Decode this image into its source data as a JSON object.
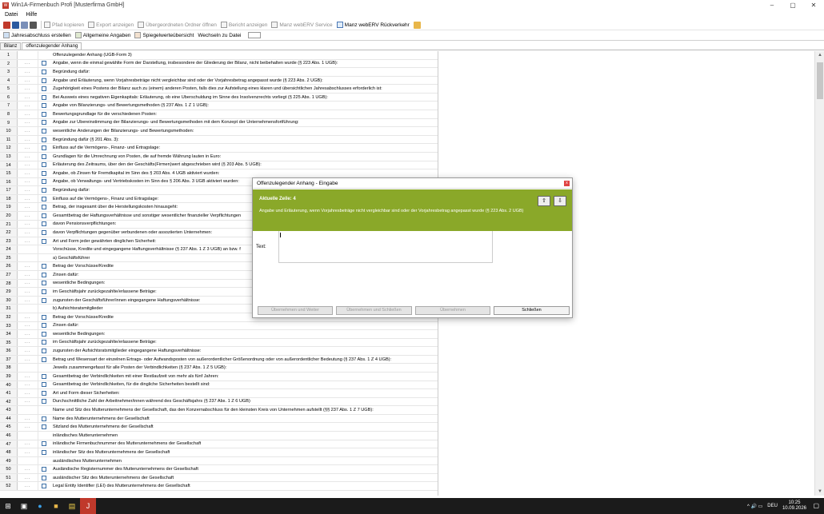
{
  "app": {
    "title": "Win1A-Firmenbuch Profi [Musterfirma GmbH]",
    "icon_label": "W",
    "minimize": "–",
    "maximize": "▢",
    "close": "✕"
  },
  "menu": [
    "Datei",
    "Hilfe"
  ],
  "toolbar1": {
    "buttons": [
      {
        "label": "Pfad kopieren",
        "enabled": false
      },
      {
        "label": "Export anzeigen",
        "enabled": false
      },
      {
        "label": "Übergeordneten Ordner öffnen",
        "enabled": false
      },
      {
        "label": "Bericht anzeigen",
        "enabled": false
      },
      {
        "label": "Manz webERV Service",
        "enabled": false
      },
      {
        "label": "Manz webERV Rückverkehr",
        "enabled": true
      }
    ]
  },
  "toolbar2": {
    "buttons": [
      {
        "label": "Jahresabschluss erstellen"
      },
      {
        "label": "Allgemeine Angaben"
      },
      {
        "label": "Spiegelwerteübersicht"
      },
      {
        "label": "Wechseln zu Datei"
      }
    ]
  },
  "tabs": [
    {
      "label": "Bilanz",
      "active": false
    },
    {
      "label": "offenzulegender Anhang",
      "active": true
    }
  ],
  "rows": [
    {
      "n": "1",
      "btn": false,
      "chk": false,
      "text": "Offenzulegender Anhang  (UGB-Form 3)"
    },
    {
      "n": "2",
      "btn": true,
      "chk": true,
      "text": "Angabe, wenn die einmal gewählte Form der Darstellung, insbesondere der Gliederung der Bilanz, nicht beibehalten wurde (§ 223 Abs. 1 UGB):"
    },
    {
      "n": "3",
      "btn": true,
      "chk": true,
      "text": "Begründung dafür:"
    },
    {
      "n": "4",
      "btn": true,
      "chk": true,
      "text": "Angabe und Erläuterung, wenn Vorjahresbeträge nicht vergleichbar sind oder der Vorjahresbetrag angepasst wurde (§ 223 Abs. 2 UGB):"
    },
    {
      "n": "5",
      "btn": true,
      "chk": true,
      "text": "Zugehörigkeit eines Postens der Bilanz auch zu (einem) anderen Posten, falls dies zur Aufstellung eines klaren und übersichtlichen Jahresabschlusses erforderlich ist:"
    },
    {
      "n": "6",
      "btn": true,
      "chk": true,
      "text": "Bei Ausweis eines negativen Eigenkapitals: Erläuterung, ob eine Überschuldung im Sinne des Insolvenzrechts vorliegt (§ 225 Abs. 1 UGB):"
    },
    {
      "n": "7",
      "btn": true,
      "chk": true,
      "text": "Angabe von Bilanzierungs- und Bewertungsmethoden (§ 237 Abs. 1 Z 1 UGB):"
    },
    {
      "n": "8",
      "btn": true,
      "chk": true,
      "text": "Bewertungsgrundlage für die verschiedenen Posten:"
    },
    {
      "n": "9",
      "btn": true,
      "chk": true,
      "text": "Angabe zur Übereinstimmung der Bilanzierungs- und Bewertungsmethoden mit dem Konzept der Unternehmensfortführung:"
    },
    {
      "n": "10",
      "btn": true,
      "chk": true,
      "text": "wesentliche Änderungen der Bilanzierungs- und Bewertungsmethoden:"
    },
    {
      "n": "11",
      "btn": true,
      "chk": true,
      "text": "Begründung dafür (§ 201 Abs. 3):"
    },
    {
      "n": "12",
      "btn": true,
      "chk": true,
      "text": "Einfluss auf die Vermögens-, Finanz- und Ertragslage:"
    },
    {
      "n": "13",
      "btn": true,
      "chk": true,
      "text": "Grundlagen für die Umrechnung von Posten, die auf fremde Währung lauten in Euro:"
    },
    {
      "n": "14",
      "btn": true,
      "chk": true,
      "text": "Erläuterung des Zeitraums, über den der Geschäfts(Firmen)wert abgeschrieben wird (§ 203 Abs. 5 UGB):"
    },
    {
      "n": "15",
      "btn": true,
      "chk": true,
      "text": "Angabe, ob Zinsen für Fremdkapital im Sinn des § 203 Abs. 4 UGB aktiviert wurden:"
    },
    {
      "n": "16",
      "btn": true,
      "chk": true,
      "text": "Angabe, ob Verwaltungs- und Vertriebskosten im Sinn des § 206 Abs. 3 UGB aktiviert wurden:"
    },
    {
      "n": "17",
      "btn": true,
      "chk": true,
      "text": "Begründung dafür:"
    },
    {
      "n": "18",
      "btn": true,
      "chk": true,
      "text": "Einfluss auf die Vermögens-, Finanz und Ertragslage:"
    },
    {
      "n": "19",
      "btn": true,
      "chk": true,
      "text": "Betrag, der insgesamt über die Herstellungskosten hinausgeht:"
    },
    {
      "n": "20",
      "btn": true,
      "chk": true,
      "text": "Gesamtbetrag der Haftungsverhältnisse und sonstiger wesentlicher finanzieller Verpflichtungen"
    },
    {
      "n": "21",
      "btn": true,
      "chk": true,
      "text": "davon Pensionsverpflichtungen:"
    },
    {
      "n": "22",
      "btn": true,
      "chk": true,
      "text": "davon Verpflichtungen gegenüber verbundenen oder assoziierten Unternehmen:"
    },
    {
      "n": "23",
      "btn": true,
      "chk": true,
      "text": "Art und Form jeder gewährten dinglichen Sicherheit:"
    },
    {
      "n": "24",
      "btn": false,
      "chk": false,
      "text": "Vorschüsse, Kredite und eingegangene Haftungsverhältnisse (§ 237 Abs. 1 Z 3 UGB) an bzw. f"
    },
    {
      "n": "25",
      "btn": false,
      "chk": false,
      "text": "a) Geschäftsführer"
    },
    {
      "n": "26",
      "btn": true,
      "chk": true,
      "text": "Betrag der Vorschüsse/Kredite"
    },
    {
      "n": "27",
      "btn": true,
      "chk": true,
      "text": "Zinsen dafür:"
    },
    {
      "n": "28",
      "btn": true,
      "chk": true,
      "text": "wesentliche Bedingungen:"
    },
    {
      "n": "29",
      "btn": true,
      "chk": true,
      "text": "im Geschäftsjahr zurückgezahlte/erlassene Beträge:"
    },
    {
      "n": "30",
      "btn": true,
      "chk": true,
      "text": "zugunsten der Geschäftsführer/innen eingegangene Haftungsverhältnisse:"
    },
    {
      "n": "31",
      "btn": false,
      "chk": false,
      "text": "b) Aufsichtsratsmitglieder"
    },
    {
      "n": "32",
      "btn": true,
      "chk": true,
      "text": "Betrag der Vorschüsse/Kredite"
    },
    {
      "n": "33",
      "btn": true,
      "chk": true,
      "text": "Zinsen dafür:"
    },
    {
      "n": "34",
      "btn": true,
      "chk": true,
      "text": "wesentliche Bedingungen:"
    },
    {
      "n": "35",
      "btn": true,
      "chk": true,
      "text": "im Geschäftsjahr zurückgezahlte/erlassene Beträge:"
    },
    {
      "n": "36",
      "btn": true,
      "chk": true,
      "text": "zugunsten der Aufsichtsratsmitglieder eingegangene Haftungsverhältnisse:"
    },
    {
      "n": "37",
      "btn": true,
      "chk": true,
      "text": "Betrag und Wesensart der einzelnen Ertrags- oder Aufwandsposten von außerordentlicher Größenordnung oder von außerordentlicher Bedeutung (§ 237 Abs. 1 Z 4 UGB):"
    },
    {
      "n": "38",
      "btn": false,
      "chk": false,
      "text": "Jeweils zusammengefasst für alle Posten der Verbindlichkeiten (§ 237 Abs. 1 Z 5 UGB):"
    },
    {
      "n": "39",
      "btn": true,
      "chk": true,
      "text": "Gesamtbetrag der Verbindlichkeiten mit einer Restlaufzeit von mehr als fünf Jahren:"
    },
    {
      "n": "40",
      "btn": true,
      "chk": true,
      "text": "Gesamtbetrag der Verbindlichkeiten, für die dingliche Sicherheiten bestellt sind:"
    },
    {
      "n": "41",
      "btn": true,
      "chk": true,
      "text": "Art und Form dieser Sicherheiten:"
    },
    {
      "n": "42",
      "btn": true,
      "chk": true,
      "text": "Durchschnittliche Zahl der Arbeitnehmer/innen während des Geschäftsjahrs (§ 237 Abs. 1 Z 6 UGB)"
    },
    {
      "n": "43",
      "btn": false,
      "chk": false,
      "text": "Name und Sitz des Mutterunternehmens der Gesellschaft, das den Konzernabschluss für den kleinsten Kreis von Unternehmen aufstellt (§§ 237 Abs. 1 Z 7 UGB):"
    },
    {
      "n": "44",
      "btn": true,
      "chk": true,
      "text": "Name des Mutterunternehmens der Gesellschaft"
    },
    {
      "n": "45",
      "btn": true,
      "chk": true,
      "text": "Sitzland des Mutterunternehmens der Gesellschaft"
    },
    {
      "n": "46",
      "btn": false,
      "chk": false,
      "text": "inländisches Mutterunternehmen"
    },
    {
      "n": "47",
      "btn": true,
      "chk": true,
      "text": "inländische Firmenbuchnummer des Mutterunternehmens der Gesellschaft"
    },
    {
      "n": "48",
      "btn": true,
      "chk": true,
      "text": "inländischer Sitz des Mutterunternehmens der Gesellschaft"
    },
    {
      "n": "49",
      "btn": false,
      "chk": false,
      "text": "ausländisches Mutterunternehmen"
    },
    {
      "n": "50",
      "btn": true,
      "chk": true,
      "text": "Ausländische Registernummer des Mutterunternehmens der Gesellschaft"
    },
    {
      "n": "51",
      "btn": true,
      "chk": true,
      "text": "ausländischer Sitz des Mutterunternehmens der Gesellschaft"
    },
    {
      "n": "52",
      "btn": true,
      "chk": true,
      "text": "Legal Entity Identifier (LEI) des Mutterunternehmens der Gesellschaft"
    }
  ],
  "row_button_label": "...",
  "dialog": {
    "title": "Offenzulegender Anhang - Eingabe",
    "close": "x",
    "current_row_label": "Aktuelle Zeile: 4",
    "current_row_text": "Angabe und Erläuterung, wenn Vorjahresbeträge nicht vergleichbar sind oder der Vorjahresbetrag angepasst wurde (§ 223 Abs. 2 UGB)",
    "text_label": "Text:",
    "text_value": "",
    "buttons": [
      {
        "label": "Übernehmen und Weiter",
        "enabled": false
      },
      {
        "label": "Übernehmen und Schließen",
        "enabled": false
      },
      {
        "label": "Übernehmen",
        "enabled": false
      },
      {
        "label": "Schließen",
        "enabled": true
      }
    ]
  },
  "taskbar": {
    "start": "⊞",
    "language": "DEU",
    "time": "10:25",
    "date": "10.09.2026",
    "tray_icons": "^ 🔊 ▭"
  }
}
